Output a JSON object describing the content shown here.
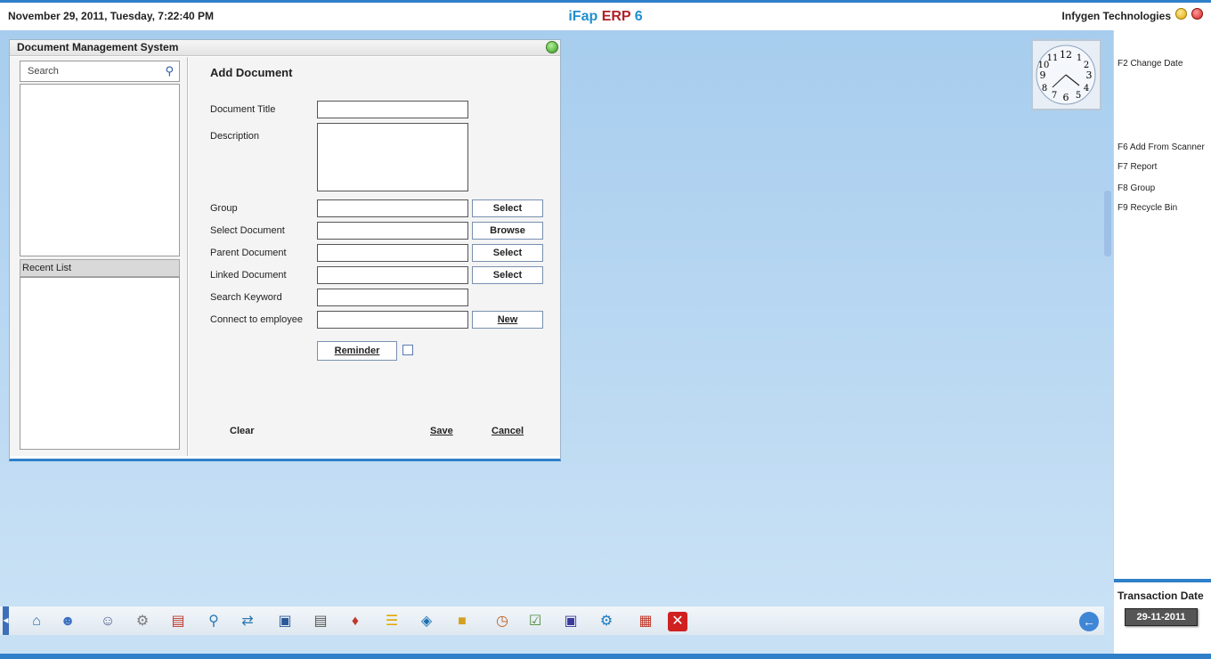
{
  "topbar": {
    "datetime": "November  29, 2011, Tuesday, 7:22:40 PM",
    "brand_part1": "iFap",
    "brand_part2": "ERP",
    "brand_part3": "6",
    "company": "Infygen Technologies"
  },
  "window": {
    "title": "Document Management System",
    "search_placeholder": "Search",
    "recent_list_label": "Recent List",
    "form_title": "Add Document",
    "fields": {
      "document_title": "Document Title",
      "description": "Description",
      "group": "Group",
      "select_document": "Select Document",
      "parent_document": "Parent Document",
      "linked_document": "Linked Document",
      "search_keyword": "Search Keyword",
      "connect_employee": "Connect to employee"
    },
    "buttons": {
      "group_select": "Select",
      "browse": "Browse",
      "parent_select": "Select",
      "linked_select": "Select",
      "new": "New",
      "reminder": "Reminder",
      "clear": "Clear",
      "save": "Save",
      "cancel": "Cancel"
    }
  },
  "shortcuts": [
    "F2 Change Date",
    "F6 Add From Scanner",
    "F7 Report",
    "F8 Group",
    "F9 Recycle Bin"
  ],
  "transaction": {
    "label": "Transaction Date",
    "date": "29-11-2011"
  },
  "colors": {
    "accent": "#2f7fc9",
    "brand_blue": "#1f8fd0",
    "brand_red": "#b0202a",
    "desktop_bg": "#b9d8f2"
  }
}
